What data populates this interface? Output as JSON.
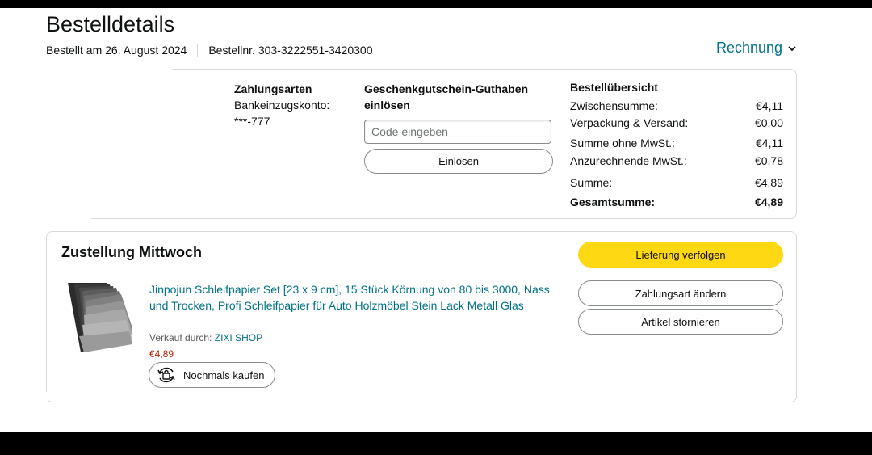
{
  "page": {
    "title": "Bestelldetails",
    "ordered_on": "Bestellt am 26. August 2024",
    "order_number": "Bestellnr. 303-3222551-3420300",
    "invoice_label": "Rechnung"
  },
  "payment": {
    "heading": "Zahlungsarten",
    "method": "Bankeinzugskonto:",
    "account": "***-777"
  },
  "gift": {
    "heading_line1": "Geschenkgutschein-Guthaben",
    "heading_line2": "einlösen",
    "placeholder": "Code eingeben",
    "redeem_label": "Einlösen"
  },
  "summary": {
    "heading": "Bestellübersicht",
    "rows": [
      {
        "label": "Zwischensumme:",
        "value": "€4,11"
      },
      {
        "label": "Verpackung & Versand:",
        "value": "€0,00"
      },
      {
        "label": "Summe ohne MwSt.:",
        "value": "€4,11"
      },
      {
        "label": "Anzurechnende MwSt.:",
        "value": "€0,78"
      },
      {
        "label": "Summe:",
        "value": "€4,89"
      },
      {
        "label": "Gesamtsumme:",
        "value": "€4,89"
      }
    ]
  },
  "shipment": {
    "heading": "Zustellung Mittwoch",
    "product_title": "Jinpojun Schleifpapier Set [23 x 9 cm], 15 Stück Körnung von 80 bis 3000, Nass und Trocken, Profi Schleifpapier für Auto Holzmöbel Stein Lack Metall Glas",
    "seller_prefix": "Verkauf durch:",
    "seller_name": "ZIXI SHOP",
    "price": "€4,89",
    "rebuy_label": "Nochmals kaufen",
    "track_label": "Lieferung verfolgen",
    "change_payment_label": "Zahlungsart ändern",
    "cancel_label": "Artikel stornieren"
  },
  "colors": {
    "link": "#007185",
    "price": "#b12704",
    "primary_button": "#ffd814",
    "border": "#d5d9d9"
  },
  "icons": {
    "invoice_chevron": "chevron-down-icon",
    "rebuy": "reorder-icon"
  }
}
